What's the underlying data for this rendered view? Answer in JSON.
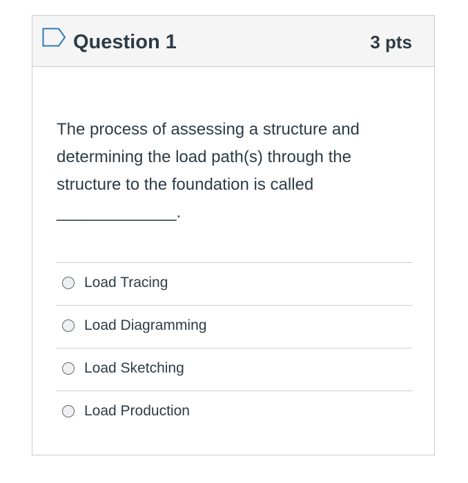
{
  "question": {
    "title": "Question 1",
    "points": "3 pts",
    "text_lines": [
      "The process of assessing a structure and",
      "determining the load path(s) through the",
      "structure to the foundation is called",
      "_____________."
    ]
  },
  "answers": [
    {
      "label": "Load Tracing"
    },
    {
      "label": "Load Diagramming"
    },
    {
      "label": "Load Sketching"
    },
    {
      "label": "Load Production"
    }
  ],
  "icons": {
    "flag": "bookmark-flag-icon"
  },
  "colors": {
    "flag_accent": "#2b7abc",
    "text": "#2d3b45",
    "header_bg": "#f5f5f5",
    "border": "#c7cdd1"
  }
}
